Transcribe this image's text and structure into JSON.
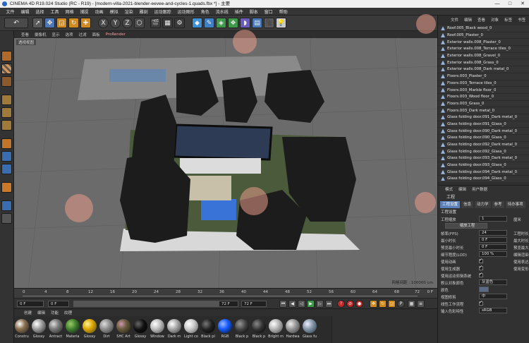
{
  "window": {
    "title": "CINEMA 4D R19.024 Studio (RC - R19) - [modern-villa-2021-blender-eevee-and-cycles-1.quads.fbx *] - 主要",
    "controls": [
      "—",
      "□",
      "✕"
    ]
  },
  "menu": [
    "文件",
    "编辑",
    "选择",
    "工具",
    "网格",
    "捕捉",
    "动画",
    "模拟",
    "渲染",
    "雕刻",
    "运动跟踪",
    "运动图形",
    "角色",
    "流水线",
    "插件",
    "脚本",
    "窗口",
    "帮助"
  ],
  "toolbar_icons": [
    "undo-icon",
    "select-arrow-icon",
    "move-icon",
    "scale-icon",
    "rotate-icon",
    "live-select-icon",
    "axis-x-icon",
    "axis-y-icon",
    "axis-z-icon",
    "coord-system-icon",
    "render-view-icon",
    "render-picture-icon",
    "render-settings-icon",
    "cube-icon",
    "pen-icon",
    "subdivision-icon",
    "cloner-icon",
    "deformer-icon",
    "floor-icon",
    "camera-icon",
    "light-icon"
  ],
  "viewport": {
    "menu": [
      "查看",
      "摄像机",
      "显示",
      "选项",
      "过滤",
      "面板",
      "ProRender"
    ],
    "label": "透视视图",
    "grid_info": "网格间距 : 100000 cm"
  },
  "timeline": {
    "ticks": [
      "0",
      "4",
      "8",
      "12",
      "16",
      "20",
      "24",
      "28",
      "32",
      "36",
      "40",
      "44",
      "48",
      "52",
      "56",
      "60",
      "64",
      "68",
      "72"
    ],
    "end_label": "0 F"
  },
  "playbar": {
    "current": "0 F",
    "start": "0 F",
    "end": "72 F",
    "end2": "72 F"
  },
  "materials": {
    "menu": [
      "创建",
      "编辑",
      "功能",
      "纹理"
    ],
    "items": [
      {
        "label": "Constru",
        "color": "#8a7050"
      },
      {
        "label": "Glossy",
        "color": "#a0a0a0"
      },
      {
        "label": "Antract",
        "color": "#7a7a7a"
      },
      {
        "label": "Materia",
        "color": "#3c7a2a"
      },
      {
        "label": "Glossy",
        "color": "#e0a800"
      },
      {
        "label": "Dirt",
        "color": "#909090"
      },
      {
        "label": "SHC Art",
        "color": "#6a5a40"
      },
      {
        "label": "Glossy",
        "color": "#111111"
      },
      {
        "label": "Window",
        "color": "#c0c0c0"
      },
      {
        "label": "Dark m",
        "color": "#aaaaaa"
      },
      {
        "label": "Light co",
        "color": "#cccccc"
      },
      {
        "label": "Black pl",
        "color": "#222222"
      },
      {
        "label": "RGB",
        "color": "#1a5cff"
      },
      {
        "label": "Black p",
        "color": "#444444"
      },
      {
        "label": "Black p",
        "color": "#333333"
      },
      {
        "label": "Bright m",
        "color": "#b8b8b8"
      },
      {
        "label": "Hardwa",
        "color": "#999999"
      },
      {
        "label": "Glass fu",
        "color": "#8899aa"
      }
    ]
  },
  "object_manager": {
    "tabs": [
      "文件",
      "编辑",
      "查看",
      "对象",
      "标签",
      "书签"
    ],
    "items": [
      "Roof.005_Black wood_0",
      "Roof.005_Plaster_0",
      "Exterior walls.008_Plaster_0",
      "Exterior walls.008_Terrace tiles_0",
      "Exterior walls.008_Gravel_0",
      "Exterior walls.008_Grass_0",
      "Exterior walls.008_Dark metal_0",
      "Floors.003_Plaster_0",
      "Floors.003_Terrace tiles_0",
      "Floors.003_Marble floor_0",
      "Floors.003_Wood floor_0",
      "Floors.003_Grass_0",
      "Floors.003_Dark metal_0",
      "Glass folding door.091_Dark metal_0",
      "Glass folding door.091_Glass_0",
      "Glass folding door.090_Dark metal_0",
      "Glass folding door.090_Glass_0",
      "Glass folding door.092_Dark metal_0",
      "Glass folding door.092_Glass_0",
      "Glass folding door.093_Dark metal_0",
      "Glass folding door.093_Glass_0",
      "Glass folding door.094_Dark metal_0",
      "Glass folding door.094_Glass_0"
    ]
  },
  "attributes": {
    "menu": [
      "模式",
      "编辑",
      "用户数据"
    ],
    "title": "工程",
    "tabs": [
      "工程设置",
      "信息",
      "动力学",
      "参考",
      "待办事项"
    ],
    "section": "工程设置",
    "rows": [
      {
        "label": "工程缩放",
        "value": "1",
        "label2": "厘米"
      },
      {
        "label": "",
        "value": "缩放工程",
        "label2": ""
      },
      {
        "label": "帧率(FPS)",
        "value": "24",
        "label2": "工程时长"
      },
      {
        "label": "最小时长",
        "value": "0 F",
        "label2": "最大时长"
      },
      {
        "label": "预览最小时长",
        "value": "0 F",
        "label2": "预览最大"
      },
      {
        "label": "细节程度(LOD)",
        "value": "100 %",
        "label2": "编辑渲染"
      },
      {
        "label": "使用动画",
        "check": true,
        "label2": "使用表达"
      },
      {
        "label": "使用生成器",
        "check": true,
        "label2": "使用变形"
      },
      {
        "label": "使用运动剪辑系统",
        "check": true,
        "label2": ""
      },
      {
        "label": "默认对象颜色",
        "value": "灰蓝色",
        "label2": ""
      },
      {
        "label": "颜色",
        "value": "",
        "label2": ""
      },
      {
        "label": "视图修剪",
        "value": "中",
        "label2": ""
      },
      {
        "label": "线性工作流程",
        "check": true,
        "label2": ""
      },
      {
        "label": "输入色彩特性",
        "value": "sRGB",
        "label2": ""
      }
    ]
  },
  "colors": {
    "accent": "#5b7fb9",
    "viewport_bg": "#6b6b6b",
    "panel_bg": "#2e2e2e"
  }
}
